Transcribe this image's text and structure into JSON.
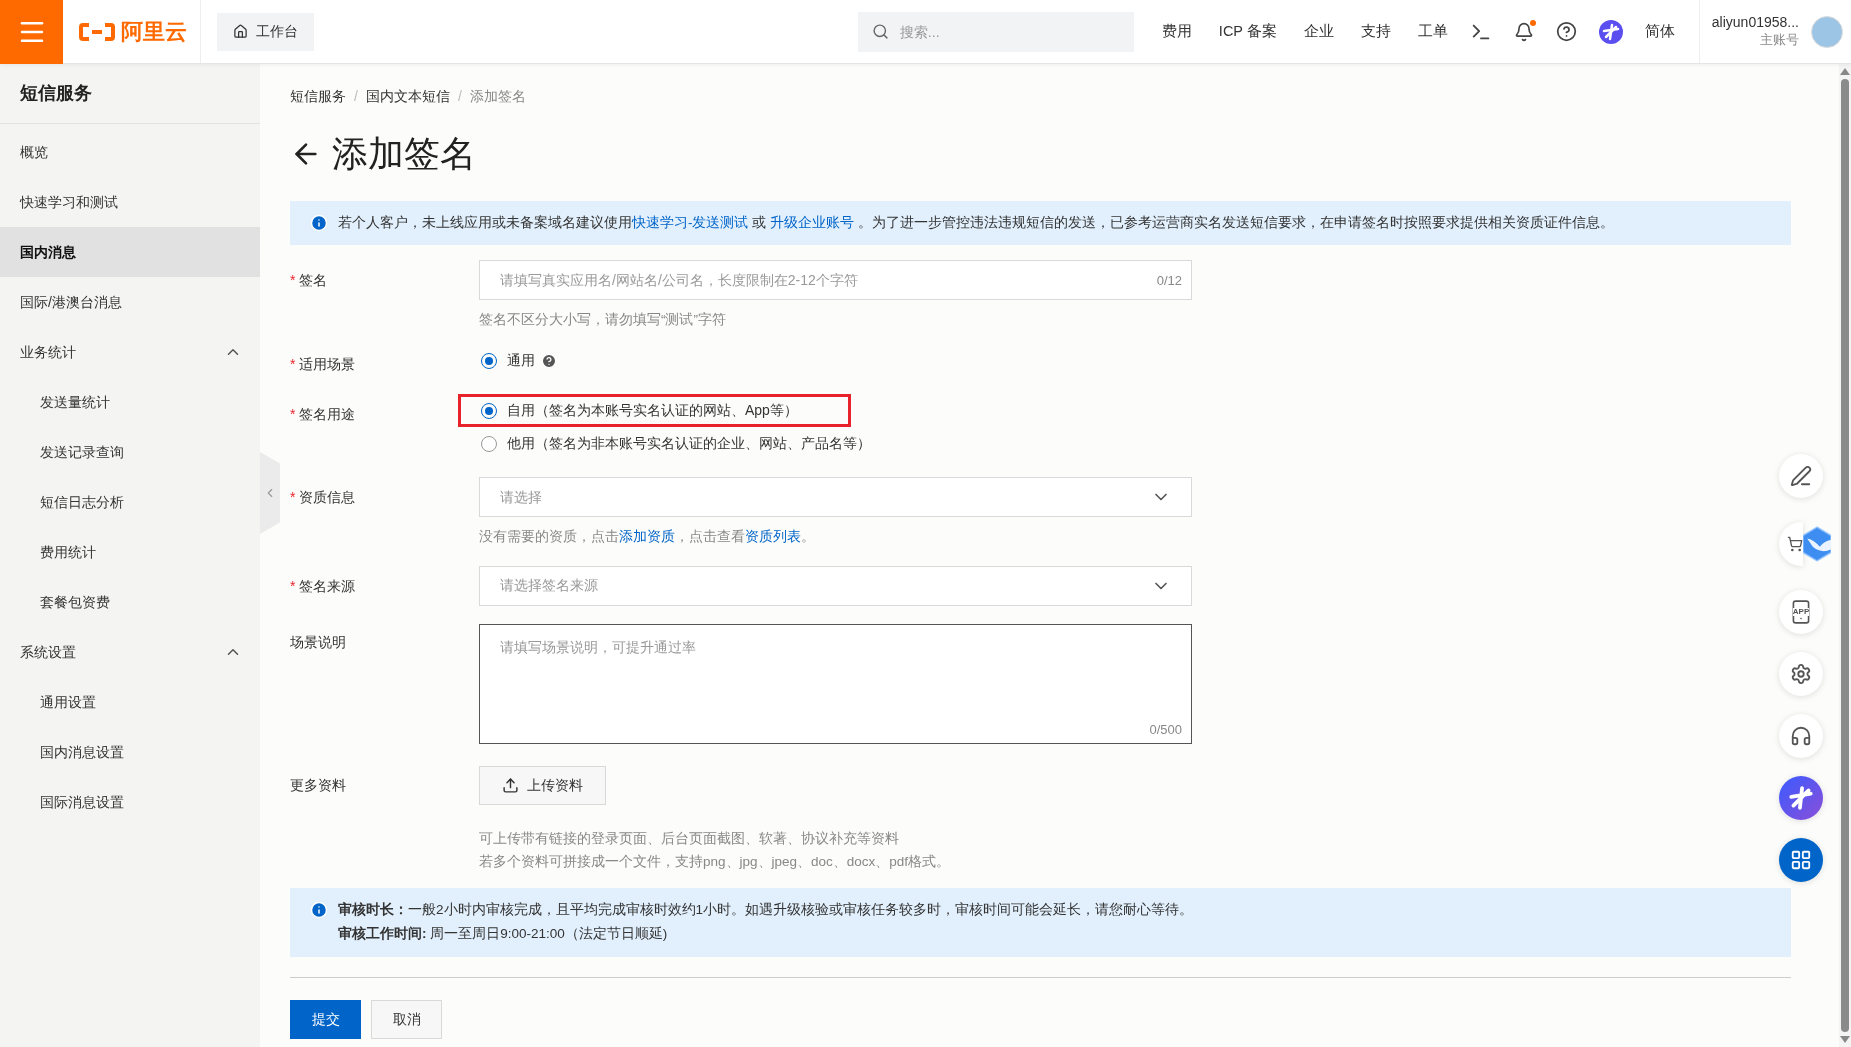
{
  "topbar": {
    "logo_text": "阿里云",
    "workbench": "工作台",
    "search": {
      "placeholder": "搜索..."
    },
    "nav": [
      "费用",
      "ICP 备案",
      "企业",
      "支持",
      "工单"
    ],
    "notification_dot": true,
    "language": "简体",
    "account": {
      "name": "aliyun01958...",
      "role": "主账号"
    }
  },
  "sidebar": {
    "title": "短信服务",
    "items": [
      {
        "label": "概览",
        "selected": false
      },
      {
        "label": "快速学习和测试",
        "selected": false
      },
      {
        "label": "国内消息",
        "selected": true
      },
      {
        "label": "国际/港澳台消息",
        "selected": false
      },
      {
        "label": "业务统计",
        "selected": false,
        "expanded": true,
        "children": [
          {
            "label": "发送量统计",
            "selected": false
          },
          {
            "label": "发送记录查询",
            "selected": false
          },
          {
            "label": "短信日志分析",
            "selected": false
          },
          {
            "label": "费用统计",
            "selected": false
          },
          {
            "label": "套餐包资费",
            "selected": false
          }
        ]
      },
      {
        "label": "系统设置",
        "selected": false,
        "expanded": true,
        "children": [
          {
            "label": "通用设置",
            "selected": false
          },
          {
            "label": "国内消息设置",
            "selected": false
          },
          {
            "label": "国际消息设置",
            "selected": false
          }
        ]
      }
    ]
  },
  "breadcrumb": [
    {
      "label": "短信服务"
    },
    {
      "separator": "/",
      "label": "国内文本短信"
    },
    {
      "separator": "/",
      "label": "添加签名"
    }
  ],
  "page_title": "添加签名",
  "notice": [
    {
      "kind": "text",
      "text": "若个人客户，未上线应用或未备案域名建议使用"
    },
    {
      "kind": "link",
      "text": "快速学习-发送测试"
    },
    {
      "kind": "text",
      "text": " 或 "
    },
    {
      "kind": "link",
      "text": "升级企业账号"
    },
    {
      "kind": "text",
      "text": " 。为了进一步管控违法违规短信的发送，已参考运营商实名发送短信要求，在申请签名时按照要求提供相关资质证件信息。"
    }
  ],
  "form": [
    {
      "kind": "input",
      "label": "签名",
      "required_mark": "*",
      "placeholder": "请填写真实应用名/网站名/公司名，长度限制在2-12个字符",
      "counter": "0/12",
      "hint": [
        {
          "kind": "text",
          "text": "签名不区分大小写，请勿填写“测试”字符"
        }
      ]
    },
    {
      "kind": "radio",
      "label": "适用场景",
      "required_mark": "*",
      "options": [
        {
          "label": "通用",
          "selected": true,
          "help": true,
          "highlighted": false
        }
      ]
    },
    {
      "kind": "radio",
      "label": "签名用途",
      "required_mark": "*",
      "options": [
        {
          "label": "自用（签名为本账号实名认证的网站、App等）",
          "selected": true,
          "help": false,
          "highlighted": true
        },
        {
          "label": "他用（签名为非本账号实名认证的企业、网站、产品名等）",
          "selected": false,
          "help": false,
          "highlighted": false
        }
      ]
    },
    {
      "kind": "select",
      "label": "资质信息",
      "required_mark": "*",
      "placeholder": "请选择",
      "hint": [
        {
          "kind": "text",
          "text": "没有需要的资质，点击"
        },
        {
          "kind": "link",
          "text": "添加资质"
        },
        {
          "kind": "text",
          "text": "，点击查看"
        },
        {
          "kind": "link",
          "text": "资质列表"
        },
        {
          "kind": "text",
          "text": "。"
        }
      ]
    },
    {
      "kind": "select",
      "label": "签名来源",
      "required_mark": "*",
      "placeholder": "请选择签名来源"
    },
    {
      "kind": "textarea",
      "label": "场景说明",
      "placeholder": "请填写场景说明，可提升通过率",
      "counter": "0/500"
    },
    {
      "kind": "upload",
      "label": "更多资料",
      "button": "上传资料",
      "notes": [
        "可上传带有链接的登录页面、后台页面截图、软著、协议补充等资料",
        "若多个资料可拼接成一个文件，支持png、jpg、jpeg、doc、docx、pdf格式。"
      ]
    }
  ],
  "review_notice": [
    "**审核时长：**一般2小时内审核完成，且平均完成审核时效约1小时。如遇升级核验或审核任务较多时，审核时间可能会延长，请您耐心等待。",
    "**审核工作时间:** 周一至周日9:00-21:00（法定节日顺延)"
  ],
  "buttons": [
    {
      "label": "提交",
      "kind": "primary"
    },
    {
      "label": "取消",
      "kind": "default"
    }
  ],
  "floating_tools": [
    {
      "kind": "edit"
    },
    {
      "kind": "cart"
    },
    {
      "kind": "app",
      "label": "APP"
    },
    {
      "kind": "settings"
    },
    {
      "kind": "support"
    },
    {
      "kind": "assistant"
    },
    {
      "kind": "apps"
    }
  ]
}
